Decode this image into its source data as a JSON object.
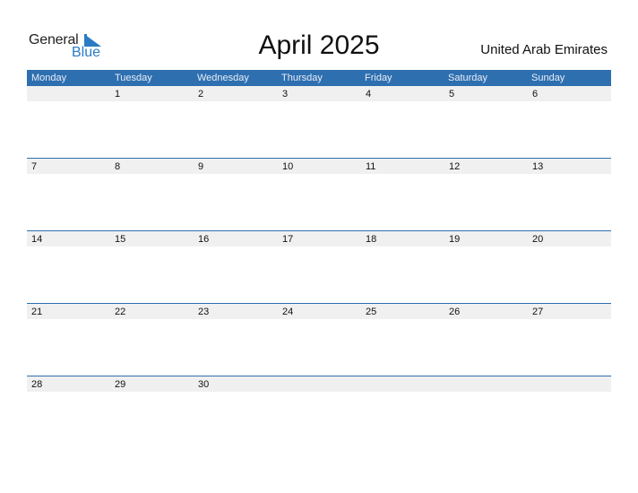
{
  "logo": {
    "word1": "General",
    "word2": "Blue"
  },
  "title": "April 2025",
  "country": "United Arab Emirates",
  "colors": {
    "header": "#2e6fb0",
    "band": "#f0f0f0",
    "accent": "#2a7bc4"
  },
  "weekdays": [
    "Monday",
    "Tuesday",
    "Wednesday",
    "Thursday",
    "Friday",
    "Saturday",
    "Sunday"
  ],
  "weeks": [
    [
      "",
      "1",
      "2",
      "3",
      "4",
      "5",
      "6"
    ],
    [
      "7",
      "8",
      "9",
      "10",
      "11",
      "12",
      "13"
    ],
    [
      "14",
      "15",
      "16",
      "17",
      "18",
      "19",
      "20"
    ],
    [
      "21",
      "22",
      "23",
      "24",
      "25",
      "26",
      "27"
    ],
    [
      "28",
      "29",
      "30",
      "",
      "",
      "",
      ""
    ]
  ]
}
